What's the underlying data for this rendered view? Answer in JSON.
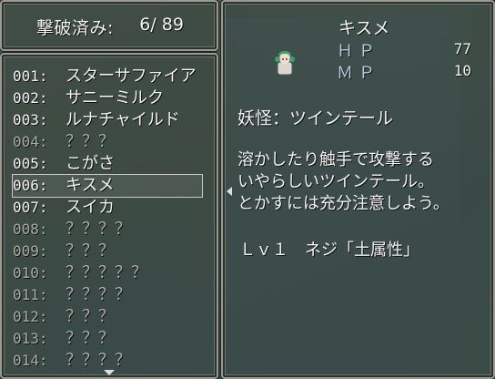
{
  "counter": {
    "label": "撃破済み:",
    "value": "6/ 89"
  },
  "list": [
    {
      "num": "001:",
      "name": "スターサファイア",
      "known": true
    },
    {
      "num": "002:",
      "name": "サニーミルク",
      "known": true
    },
    {
      "num": "003:",
      "name": "ルナチャイルド",
      "known": true
    },
    {
      "num": "004:",
      "name": "？？？",
      "known": false
    },
    {
      "num": "005:",
      "name": "こがさ",
      "known": true
    },
    {
      "num": "006:",
      "name": "キスメ",
      "known": true,
      "selected": true
    },
    {
      "num": "007:",
      "name": "スイカ",
      "known": true
    },
    {
      "num": "008:",
      "name": "？？？？",
      "known": false
    },
    {
      "num": "009:",
      "name": "？？？",
      "known": false
    },
    {
      "num": "010:",
      "name": "？？？？？",
      "known": false
    },
    {
      "num": "011:",
      "name": "？？？？",
      "known": false
    },
    {
      "num": "012:",
      "name": "？？？",
      "known": false
    },
    {
      "num": "013:",
      "name": "？？？",
      "known": false
    },
    {
      "num": "014:",
      "name": "？？？？",
      "known": false
    }
  ],
  "detail": {
    "name": "キスメ",
    "hp_label": "ＨＰ",
    "hp_value": "77",
    "mp_label": "ＭＰ",
    "mp_value": "10",
    "type": "妖怪：ツインテール",
    "description": [
      "溶かしたり触手で攻撃する",
      "いやらしいツインテール。",
      "とかすには充分注意しよう。"
    ],
    "level": "Ｌｖ１　ネジ「土属性」"
  },
  "colors": {
    "known_text": "#f2f2f2",
    "unknown_text": "#a8aca8",
    "stat_label": "#b8c8e0"
  }
}
